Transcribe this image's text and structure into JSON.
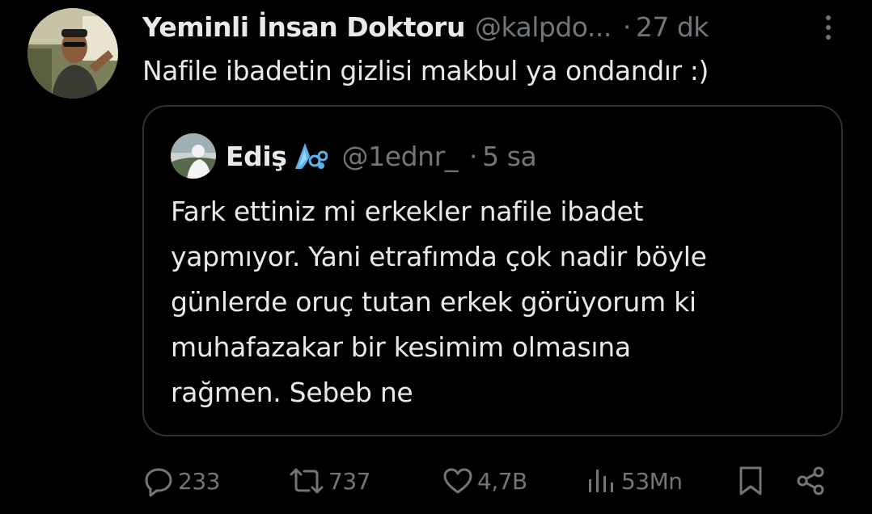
{
  "tweet": {
    "display_name": "Yeminli İnsan Doktoru",
    "handle": "@kalpdo...",
    "dot": "·",
    "time": "27 dk",
    "text": "Nafile ibadetin gizlisi makbul ya ondandır :)",
    "avatar_icon": "profile-photo"
  },
  "quoted_tweet": {
    "display_name": "Ediş",
    "name_emoji": "💦",
    "handle": "@1ednr_",
    "dot": "·",
    "time": "5 sa",
    "text_lines": [
      "Fark ettiniz mi erkekler nafile ibadet",
      "yapmıyor. Yani etrafımda çok nadir böyle",
      "günlerde oruç tutan erkek görüyorum ki",
      "muhafazakar bir kesimim olmasına",
      "rağmen. Sebeb ne"
    ]
  },
  "actions": {
    "replies": "233",
    "retweets": "737",
    "likes": "4,7B",
    "views": "53Mn"
  },
  "colors": {
    "background": "#000000",
    "primary_text": "#e7e9ea",
    "secondary_text": "#71767b",
    "border": "#2f3336"
  }
}
